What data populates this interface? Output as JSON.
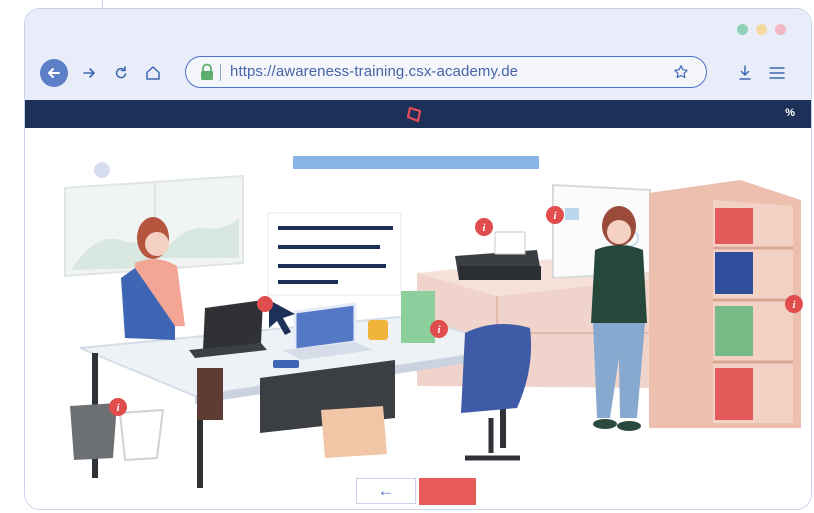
{
  "browser": {
    "url": "https://awareness-training.csx-academy.de",
    "window_dots": [
      "#8fd0b7",
      "#f5d9a0",
      "#f1b8c4"
    ]
  },
  "app": {
    "progress_label": "%"
  },
  "controls": {
    "back_arrow": "←"
  },
  "icons": {
    "back": "back-arrow-icon",
    "forward": "forward-arrow-icon",
    "reload": "reload-icon",
    "home": "home-icon",
    "lock": "lock-icon",
    "bookmark": "star-icon",
    "download": "download-icon",
    "menu": "hamburger-menu-icon",
    "logo": "brand-logo-icon",
    "hotspot": "info-icon"
  },
  "colors": {
    "app_bar": "#1d3158",
    "accent": "#e75b5b",
    "hotspot": "#e04d4d",
    "progress_bar": "#8ab3e6"
  }
}
